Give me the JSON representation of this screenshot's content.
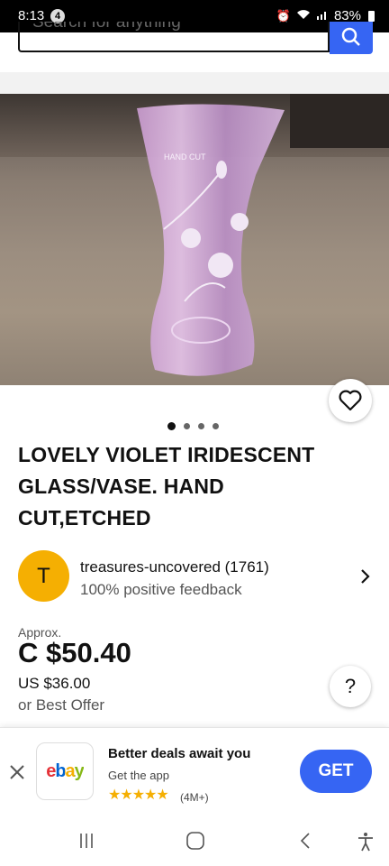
{
  "status_bar": {
    "time": "8:13",
    "notification_count": "4",
    "battery": "83%"
  },
  "search": {
    "placeholder": "Search for anything"
  },
  "listing": {
    "title": "LOVELY VIOLET IRIDESCENT GLASS/VASE. HAND CUT,ETCHED",
    "image_text": "HAND CUT",
    "image_count": 4,
    "active_image": 1
  },
  "seller": {
    "initial": "T",
    "name": "treasures-uncovered (1761)",
    "feedback": "100% positive feedback"
  },
  "pricing": {
    "approx_label": "Approx.",
    "price": "C $50.40",
    "us_price": "US $36.00",
    "offer": "or Best Offer"
  },
  "help": {
    "label": "?"
  },
  "app_banner": {
    "logo": "ebay",
    "title": "Better deals await you",
    "subtitle": "Get the app",
    "rating_stars": 5,
    "rating_count": "(4M+)",
    "cta": "GET"
  },
  "colors": {
    "brand_blue": "#3665f3",
    "avatar_yellow": "#f5af02"
  },
  "icons": [
    "search-icon",
    "heart-icon",
    "chevron-right-icon",
    "close-icon",
    "recents-icon",
    "home-icon",
    "back-icon",
    "accessibility-icon"
  ]
}
